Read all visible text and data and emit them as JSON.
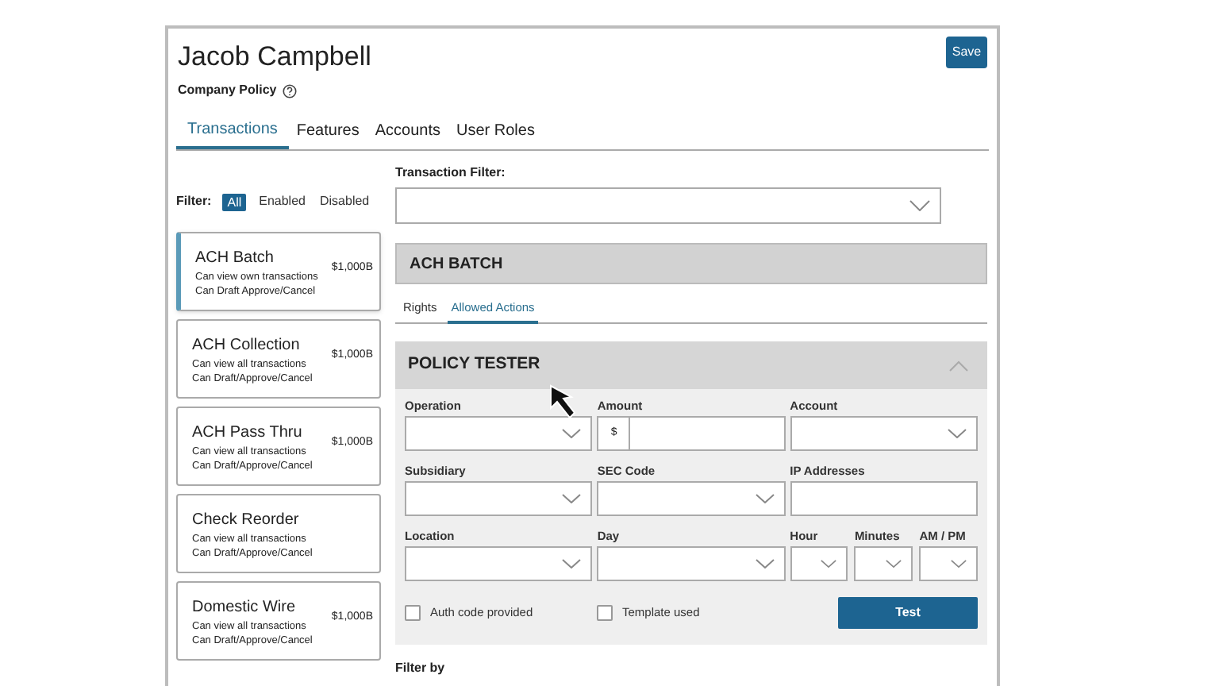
{
  "header": {
    "title": "Jacob Campbell",
    "subtitle": "Company Policy",
    "save_button": "Save"
  },
  "tabs": [
    {
      "label": "Transactions",
      "selected": true
    },
    {
      "label": "Features",
      "selected": false
    },
    {
      "label": "Accounts",
      "selected": false
    },
    {
      "label": "User Roles",
      "selected": false
    }
  ],
  "filter": {
    "label": "Filter:",
    "options": [
      {
        "label": "All",
        "selected": true
      },
      {
        "label": "Enabled",
        "selected": false
      },
      {
        "label": "Disabled",
        "selected": false
      }
    ]
  },
  "transaction_filter": {
    "label": "Transaction Filter:"
  },
  "transactions": [
    {
      "name": "ACH Batch",
      "lines": [
        "Can view own transactions",
        "Can Draft Approve/Cancel"
      ],
      "amount": "$1,000B",
      "selected": true
    },
    {
      "name": "ACH Collection",
      "lines": [
        "Can view all transactions",
        "Can Draft/Approve/Cancel"
      ],
      "amount": "$1,000B",
      "selected": false
    },
    {
      "name": "ACH Pass Thru",
      "lines": [
        "Can view all transactions",
        "Can Draft/Approve/Cancel"
      ],
      "amount": "$1,000B",
      "selected": false
    },
    {
      "name": "Check Reorder",
      "lines": [
        "Can view all transactions",
        "Can Draft/Approve/Cancel"
      ],
      "selected": false
    },
    {
      "name": "Domestic Wire",
      "lines": [
        "Can view all transactions",
        "Can Draft/Approve/Cancel"
      ],
      "amount": "$1,000B",
      "selected": false
    }
  ],
  "detail": {
    "title": "ACH BATCH",
    "sub_tabs": [
      {
        "label": "Rights",
        "selected": false
      },
      {
        "label": "Allowed Actions",
        "selected": true
      }
    ],
    "policy_tester": {
      "title": "POLICY TESTER",
      "expanded": true,
      "fields": [
        {
          "label": "Operation",
          "kind": "select"
        },
        {
          "label": "Amount",
          "kind": "amount",
          "prefix": "$"
        },
        {
          "label": "Account",
          "kind": "select"
        },
        {
          "label": "Subsidiary",
          "kind": "select"
        },
        {
          "label": "SEC Code",
          "kind": "select"
        },
        {
          "label": "IP Addresses",
          "kind": "text"
        },
        {
          "label": "Location",
          "kind": "select"
        },
        {
          "label": "Day",
          "kind": "select"
        },
        {
          "label": "Hour",
          "kind": "compact"
        },
        {
          "label": "Minutes",
          "kind": "compact"
        },
        {
          "label": "AM / PM",
          "kind": "compact"
        }
      ],
      "checkboxes": [
        {
          "label": "Auth code provided",
          "checked": false
        },
        {
          "label": "Template used",
          "checked": false
        }
      ],
      "test_button": "Test"
    },
    "filter_by": "Filter by"
  }
}
